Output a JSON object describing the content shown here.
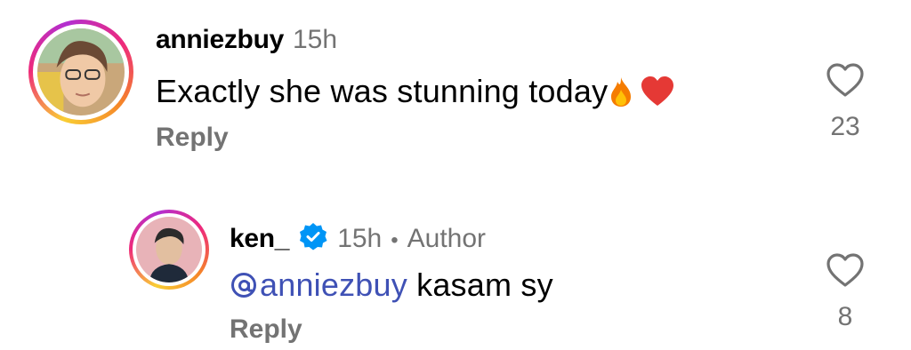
{
  "comments": [
    {
      "username": "anniezbuy",
      "time": "15h",
      "text": "Exactly she was stunning today",
      "emojis": [
        "fire-emoji",
        "red-heart-emoji"
      ],
      "reply_label": "Reply",
      "like_count": "23"
    },
    {
      "username": "ken_",
      "time": "15h",
      "separator": "•",
      "author_label": "Author",
      "mention": "anniezbuy",
      "text": " kasam sy",
      "reply_label": "Reply",
      "like_count": "8"
    }
  ],
  "colors": {
    "secondary_text": "#737373",
    "mention": "#3f51b5",
    "verified": "#0095f6"
  }
}
